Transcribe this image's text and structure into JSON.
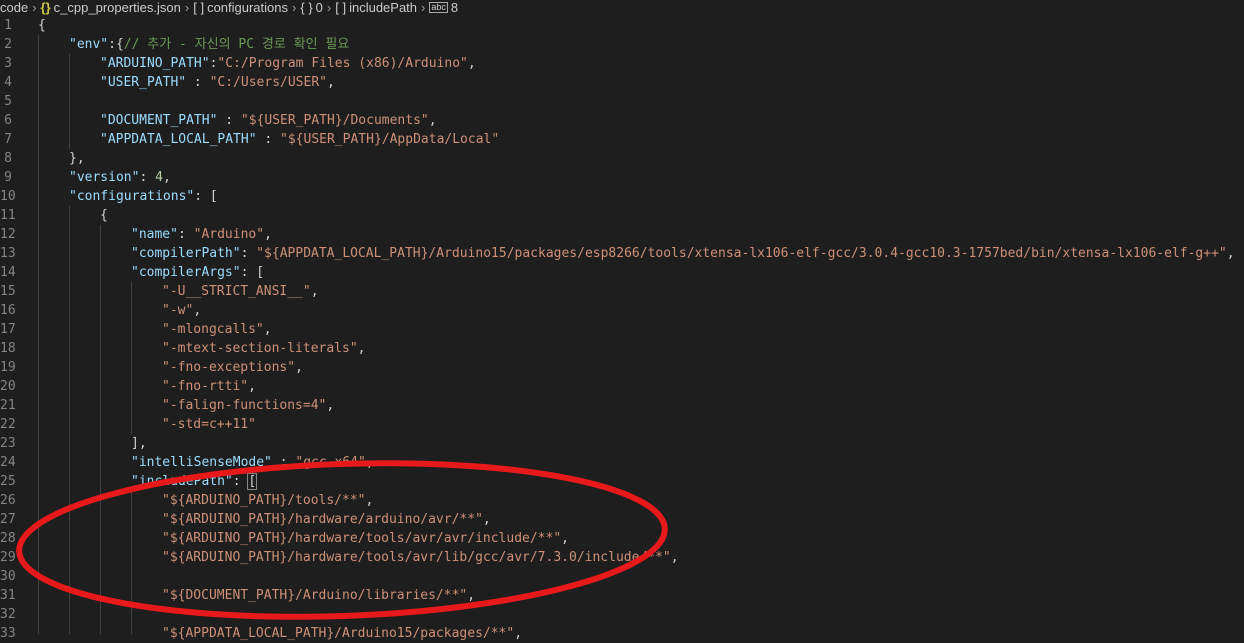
{
  "breadcrumb": {
    "items": [
      {
        "icon": "",
        "label": "code"
      },
      {
        "icon": "{}",
        "label": "c_cpp_properties.json"
      },
      {
        "icon": "[ ]",
        "label": "configurations"
      },
      {
        "icon": "{ }",
        "label": "0"
      },
      {
        "icon": "[ ]",
        "label": "includePath"
      },
      {
        "icon": "abc",
        "label": "8"
      }
    ]
  },
  "lines": [
    {
      "n": "1"
    },
    {
      "n": "2"
    },
    {
      "n": "3"
    },
    {
      "n": "4"
    },
    {
      "n": "5"
    },
    {
      "n": "6"
    },
    {
      "n": "7"
    },
    {
      "n": "8"
    },
    {
      "n": "9"
    },
    {
      "n": "10"
    },
    {
      "n": "11"
    },
    {
      "n": "12"
    },
    {
      "n": "13"
    },
    {
      "n": "14"
    },
    {
      "n": "15"
    },
    {
      "n": "16"
    },
    {
      "n": "17"
    },
    {
      "n": "18"
    },
    {
      "n": "19"
    },
    {
      "n": "20"
    },
    {
      "n": "21"
    },
    {
      "n": "22"
    },
    {
      "n": "23"
    },
    {
      "n": "24"
    },
    {
      "n": "25"
    },
    {
      "n": "26"
    },
    {
      "n": "27"
    },
    {
      "n": "28"
    },
    {
      "n": "29"
    },
    {
      "n": "30"
    },
    {
      "n": "31"
    },
    {
      "n": "32"
    },
    {
      "n": "33"
    }
  ],
  "code": {
    "l1": "{",
    "l2_key": "\"env\"",
    "l2_rest": ":{",
    "l2_comment": "// 추가 - 자신의 PC 경로 확인 필요",
    "l3_key": "\"ARDUINO_PATH\"",
    "l3_val": "\"C:/Program Files (x86)/Arduino\"",
    "l4_key": "\"USER_PATH\"",
    "l4_val": "\"C:/Users/USER\"",
    "l6_key": "\"DOCUMENT_PATH\"",
    "l6_val": "\"${USER_PATH}/Documents\"",
    "l7_key": "\"APPDATA_LOCAL_PATH\"",
    "l7_val": "\"${USER_PATH}/AppData/Local\"",
    "l8": "},",
    "l9_key": "\"version\"",
    "l9_val": "4",
    "l10_key": "\"configurations\"",
    "l10_rest": ": [",
    "l11": "{",
    "l12_key": "\"name\"",
    "l12_val": "\"Arduino\"",
    "l13_key": "\"compilerPath\"",
    "l13_val": "\"${APPDATA_LOCAL_PATH}/Arduino15/packages/esp8266/tools/xtensa-lx106-elf-gcc/3.0.4-gcc10.3-1757bed/bin/xtensa-lx106-elf-g++\"",
    "l14_key": "\"compilerArgs\"",
    "l14_rest": ": [",
    "l15": "\"-U__STRICT_ANSI__\"",
    "l16": "\"-w\"",
    "l17": "\"-mlongcalls\"",
    "l18": "\"-mtext-section-literals\"",
    "l19": "\"-fno-exceptions\"",
    "l20": "\"-fno-rtti\"",
    "l21": "\"-falign-functions=4\"",
    "l22": "\"-std=c++11\"",
    "l23": "],",
    "l24_key": "\"intelliSenseMode\"",
    "l24_val": "\"gcc-x64\"",
    "l25_key": "\"includePath\"",
    "l25_rest": ": ",
    "l25_bracket": "[",
    "l26": "\"${ARDUINO_PATH}/tools/**\"",
    "l27": "\"${ARDUINO_PATH}/hardware/arduino/avr/**\"",
    "l28": "\"${ARDUINO_PATH}/hardware/tools/avr/avr/include/**\"",
    "l29": "\"${ARDUINO_PATH}/hardware/tools/avr/lib/gcc/avr/7.3.0/include/**\"",
    "l31": "\"${DOCUMENT_PATH}/Arduino/libraries/**\"",
    "l33": "\"${APPDATA_LOCAL_PATH}/Arduino15/packages/**\""
  },
  "annotation": {
    "color": "#e8191b"
  },
  "colors": {
    "background": "#1e1e1e",
    "key": "#9cdcfe",
    "string": "#ce9178",
    "number": "#b5cea8",
    "comment": "#6a9955"
  }
}
